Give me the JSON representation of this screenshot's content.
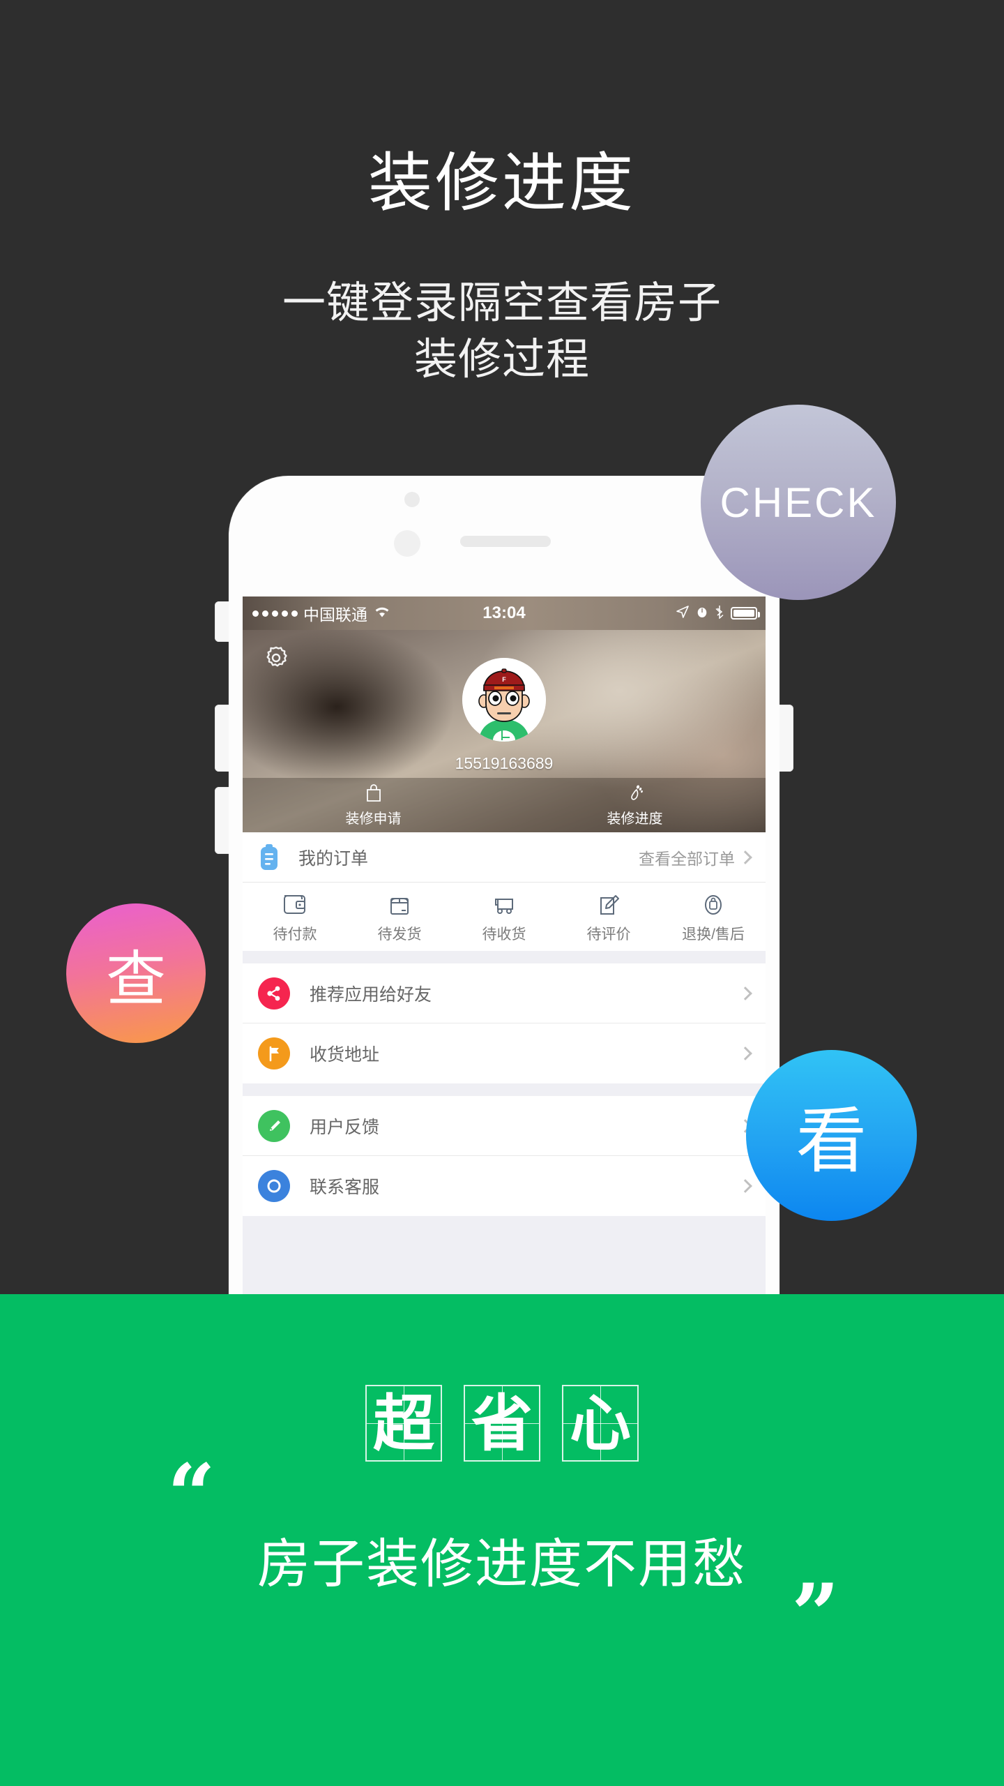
{
  "page": {
    "background_color": "#2e2e2e",
    "accent_green": "#04bd63"
  },
  "hero": {
    "headline": "装修进度",
    "subhead_line1": "一键登录隔空查看房子",
    "subhead_line2": "装修过程"
  },
  "bubbles": [
    {
      "id": "check",
      "label": "CHECK",
      "gradient_from": "#c3c6d8",
      "gradient_to": "#9b95b9"
    },
    {
      "id": "cha",
      "label": "查",
      "gradient_from": "#e95fd0",
      "gradient_to": "#f99a45"
    },
    {
      "id": "kan",
      "label": "看",
      "gradient_from": "#31c3f5",
      "gradient_to": "#0c86f0"
    }
  ],
  "phone": {
    "statusbar": {
      "signal_dots": 5,
      "carrier": "中国联通",
      "wifi_icon": "wifi-icon",
      "time": "13:04",
      "location_icon": "location-arrow-icon",
      "alarm_icon": "alarm-clock-icon",
      "bluetooth_icon": "bluetooth-icon",
      "battery_icon": "battery-icon"
    },
    "profile": {
      "settings_icon": "gear-icon",
      "avatar_icon": "user-avatar",
      "phone_number": "15519163689",
      "quick_actions": [
        {
          "icon": "shopping-bag-icon",
          "label": "装修申请"
        },
        {
          "icon": "footprint-icon",
          "label": "装修进度"
        }
      ]
    },
    "orders": {
      "icon": "clipboard-icon",
      "title": "我的订单",
      "view_all": "查看全部订单",
      "chevron_icon": "chevron-right-icon",
      "statuses": [
        {
          "icon": "wallet-icon",
          "label": "待付款"
        },
        {
          "icon": "box-icon",
          "label": "待发货"
        },
        {
          "icon": "truck-icon",
          "label": "待收货"
        },
        {
          "icon": "pencil-note-icon",
          "label": "待评价"
        },
        {
          "icon": "return-bag-icon",
          "label": "退换/售后"
        }
      ]
    },
    "menu_group_1": [
      {
        "icon": "share-icon",
        "label": "推荐应用给好友",
        "color": "#f5254f"
      },
      {
        "icon": "flag-icon",
        "label": "收货地址",
        "color": "#f49a1b"
      }
    ],
    "menu_group_2": [
      {
        "icon": "pen-icon",
        "label": "用户反馈",
        "color": "#3fc25f"
      },
      {
        "icon": "headset-icon",
        "label": "联系客服",
        "color": "#3b82dd"
      }
    ]
  },
  "footer": {
    "grid_chars": [
      "超",
      "省",
      "心"
    ],
    "quote_open": "“",
    "quote_close": "”",
    "tagline": "房子装修进度不用愁"
  }
}
